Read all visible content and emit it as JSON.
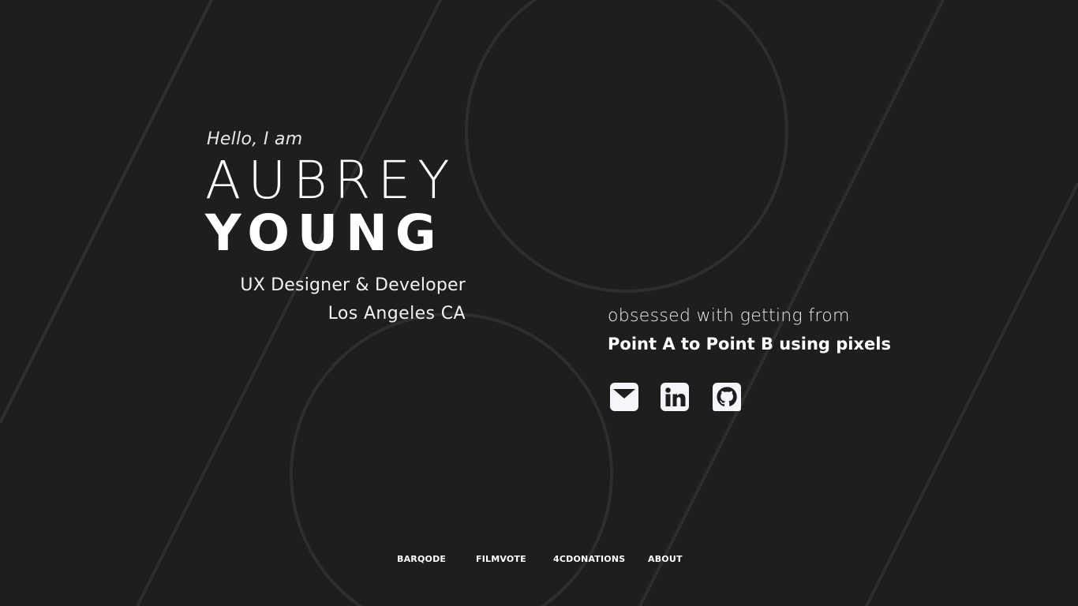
{
  "hero": {
    "greeting": "Hello, I am",
    "first_name": "AUBREY",
    "last_name": "YOUNG",
    "role": "UX Designer & Developer",
    "location": "Los Angeles CA"
  },
  "tagline": {
    "line1": "obsessed with getting from",
    "line2": "Point A to Point B using pixels"
  },
  "social": [
    {
      "icon": "email-icon"
    },
    {
      "icon": "linkedin-icon"
    },
    {
      "icon": "github-icon"
    }
  ],
  "nav": {
    "items": [
      {
        "label": "BARQODE"
      },
      {
        "label": "FILMVOTE"
      },
      {
        "label": "4CDONATIONS"
      },
      {
        "label": "ABOUT"
      }
    ]
  },
  "colors": {
    "background": "#1e1e1e",
    "decoration": "#2e2e2e",
    "text": "#ffffff"
  }
}
